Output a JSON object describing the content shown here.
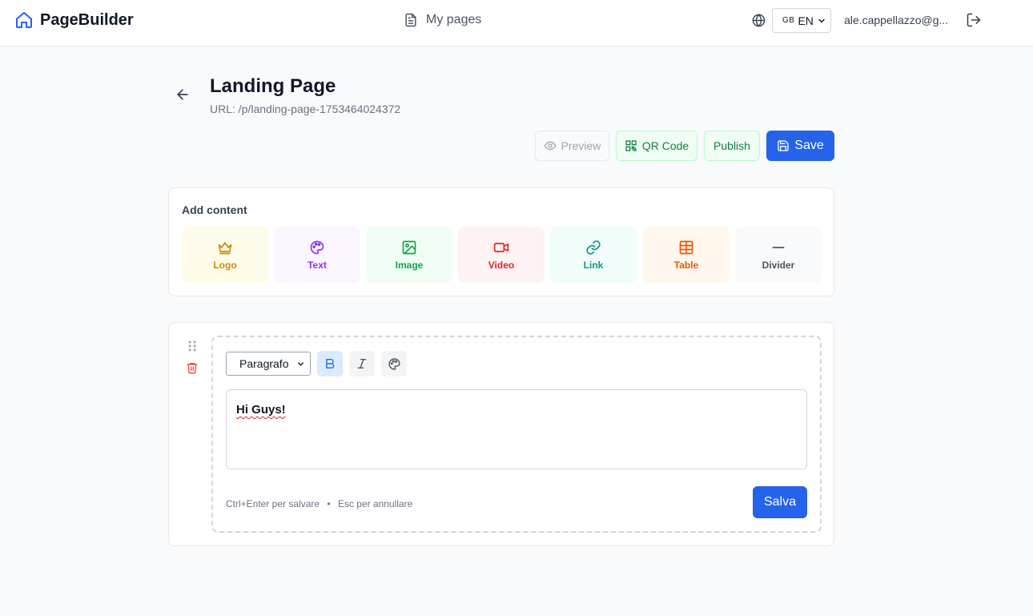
{
  "header": {
    "brand": "PageBuilder",
    "nav_my_pages": "My pages",
    "language": {
      "flag": "GB",
      "code": "EN"
    },
    "user_email": "ale.cappellazzo@g..."
  },
  "page": {
    "title": "Landing Page",
    "url": "URL: /p/landing-page-1753464024372"
  },
  "actions": {
    "preview": "Preview",
    "qr_code": "QR Code",
    "publish": "Publish",
    "save": "Save"
  },
  "add_content": {
    "title": "Add content",
    "items": [
      {
        "label": "Logo",
        "icon": "crown-icon",
        "bg": "#fefce8",
        "color": "#ca8a04"
      },
      {
        "label": "Text",
        "icon": "palette-icon",
        "bg": "#faf5ff",
        "color": "#9333ea"
      },
      {
        "label": "Image",
        "icon": "image-icon",
        "bg": "#f0fdf4",
        "color": "#16a34a"
      },
      {
        "label": "Video",
        "icon": "video-icon",
        "bg": "#fef2f2",
        "color": "#dc2626"
      },
      {
        "label": "Link",
        "icon": "link-icon",
        "bg": "#f0fdfa",
        "color": "#0d9488"
      },
      {
        "label": "Table",
        "icon": "table-icon",
        "bg": "#fff7ed",
        "color": "#ea580c"
      },
      {
        "label": "Divider",
        "icon": "minus-icon",
        "bg": "#f9fafb",
        "color": "#4b5563"
      }
    ]
  },
  "editor": {
    "format_select": "Paragrafo",
    "content": "Hi Guys!",
    "hint_save": "Ctrl+Enter per salvare",
    "hint_separator": "•",
    "hint_cancel": "Esc per annullare",
    "save_button": "Salva"
  },
  "colors": {
    "primary": "#2563eb",
    "publish_green": "#15803d",
    "danger": "#ef4444"
  }
}
